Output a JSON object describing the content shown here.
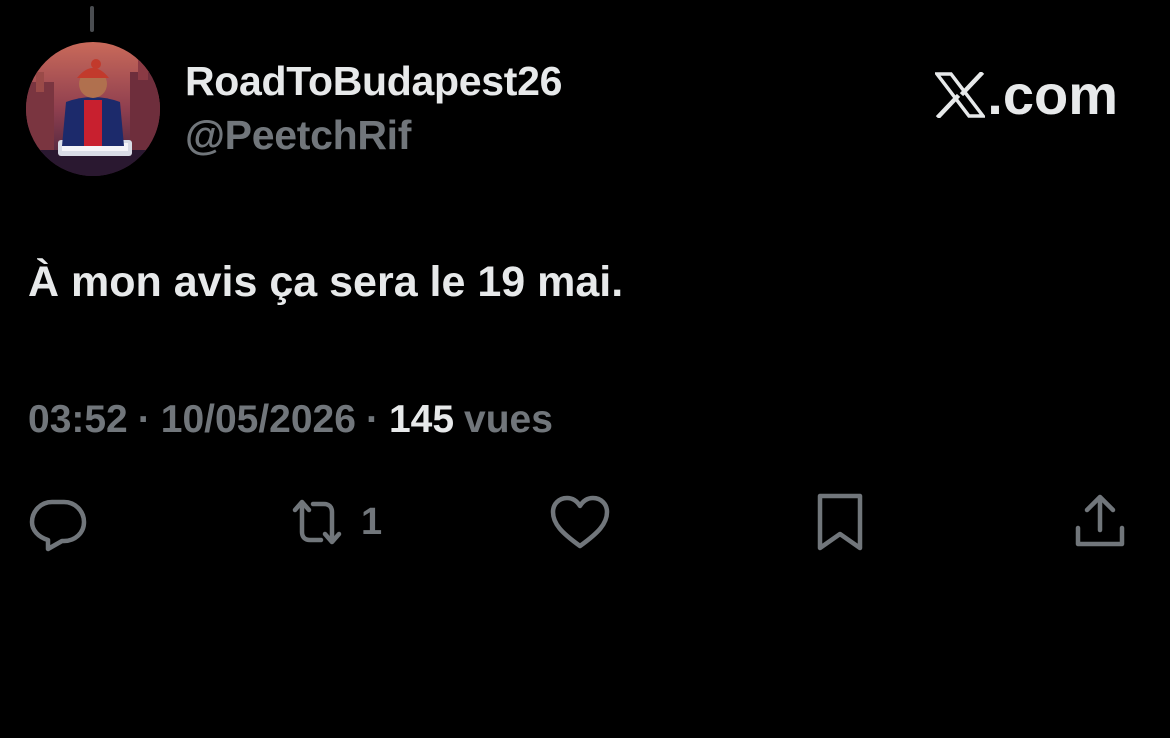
{
  "author": {
    "display_name": "RoadToBudapest26",
    "handle": "@PeetchRif"
  },
  "brand": {
    "domain_text": ".com",
    "logo_icon": "x-logo-icon"
  },
  "tweet": {
    "text": "À mon avis ça sera le 19 mai.",
    "time": "03:52",
    "separator": "·",
    "date": "10/05/2026",
    "views_count": "145",
    "views_label": "vues"
  },
  "actions": {
    "reply": {
      "icon": "reply-icon"
    },
    "retweet": {
      "icon": "retweet-icon",
      "count": "1"
    },
    "like": {
      "icon": "heart-icon"
    },
    "bookmark": {
      "icon": "bookmark-icon"
    },
    "share": {
      "icon": "share-icon"
    }
  },
  "colors": {
    "background": "#000000",
    "primary_text": "#e7e9ea",
    "secondary_text": "#71767b"
  }
}
